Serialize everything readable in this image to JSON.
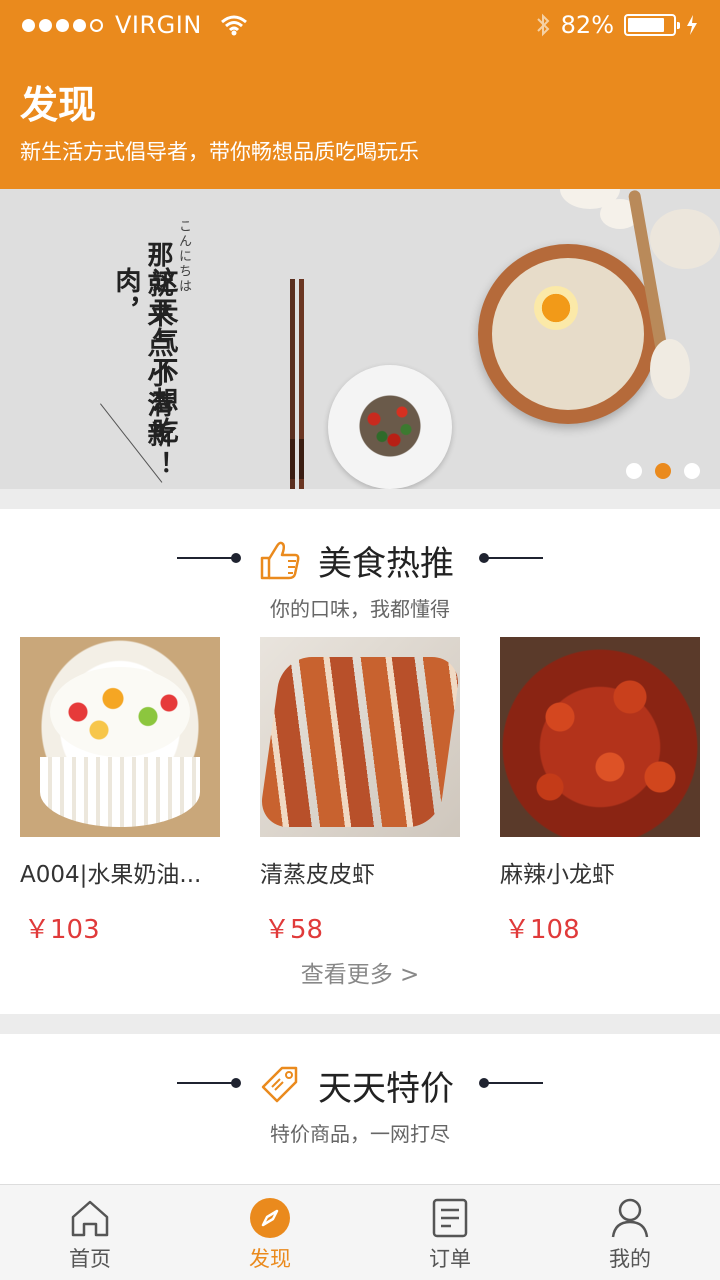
{
  "status_bar": {
    "carrier": "VIRGIN",
    "battery_percent": "82%",
    "battery_level": 0.82,
    "signal_bars_filled": 4,
    "signal_bars_total": 5
  },
  "header": {
    "title": "发现",
    "subtitle": "新生活方式倡导者，带你畅想品质吃喝玩乐",
    "color": "#ea8a1d"
  },
  "banner": {
    "kana": "こんにちは",
    "line1": "那就来点小清新！",
    "line2": "这天气不想吃肉，",
    "page_count": 3,
    "active_page": 2
  },
  "section_hot": {
    "title": "美食热推",
    "subtitle": "你的口味，我都懂得",
    "icon": "thumbs-up-icon",
    "items": [
      {
        "name": "A004|水果奶油...",
        "price": "￥103"
      },
      {
        "name": "清蒸皮皮虾",
        "price": "￥58"
      },
      {
        "name": "麻辣小龙虾",
        "price": "￥108"
      }
    ],
    "more": "查看更多 >"
  },
  "section_deal": {
    "title": "天天特价",
    "subtitle": "特价商品，一网打尽",
    "icon": "price-tag-icon"
  },
  "tabbar": {
    "tabs": [
      {
        "label": "首页",
        "icon": "home-icon"
      },
      {
        "label": "发现",
        "icon": "compass-icon",
        "active": true
      },
      {
        "label": "订单",
        "icon": "order-icon"
      },
      {
        "label": "我的",
        "icon": "user-icon"
      }
    ]
  },
  "colors": {
    "accent": "#ea8a1d",
    "price": "#e03a3a"
  }
}
